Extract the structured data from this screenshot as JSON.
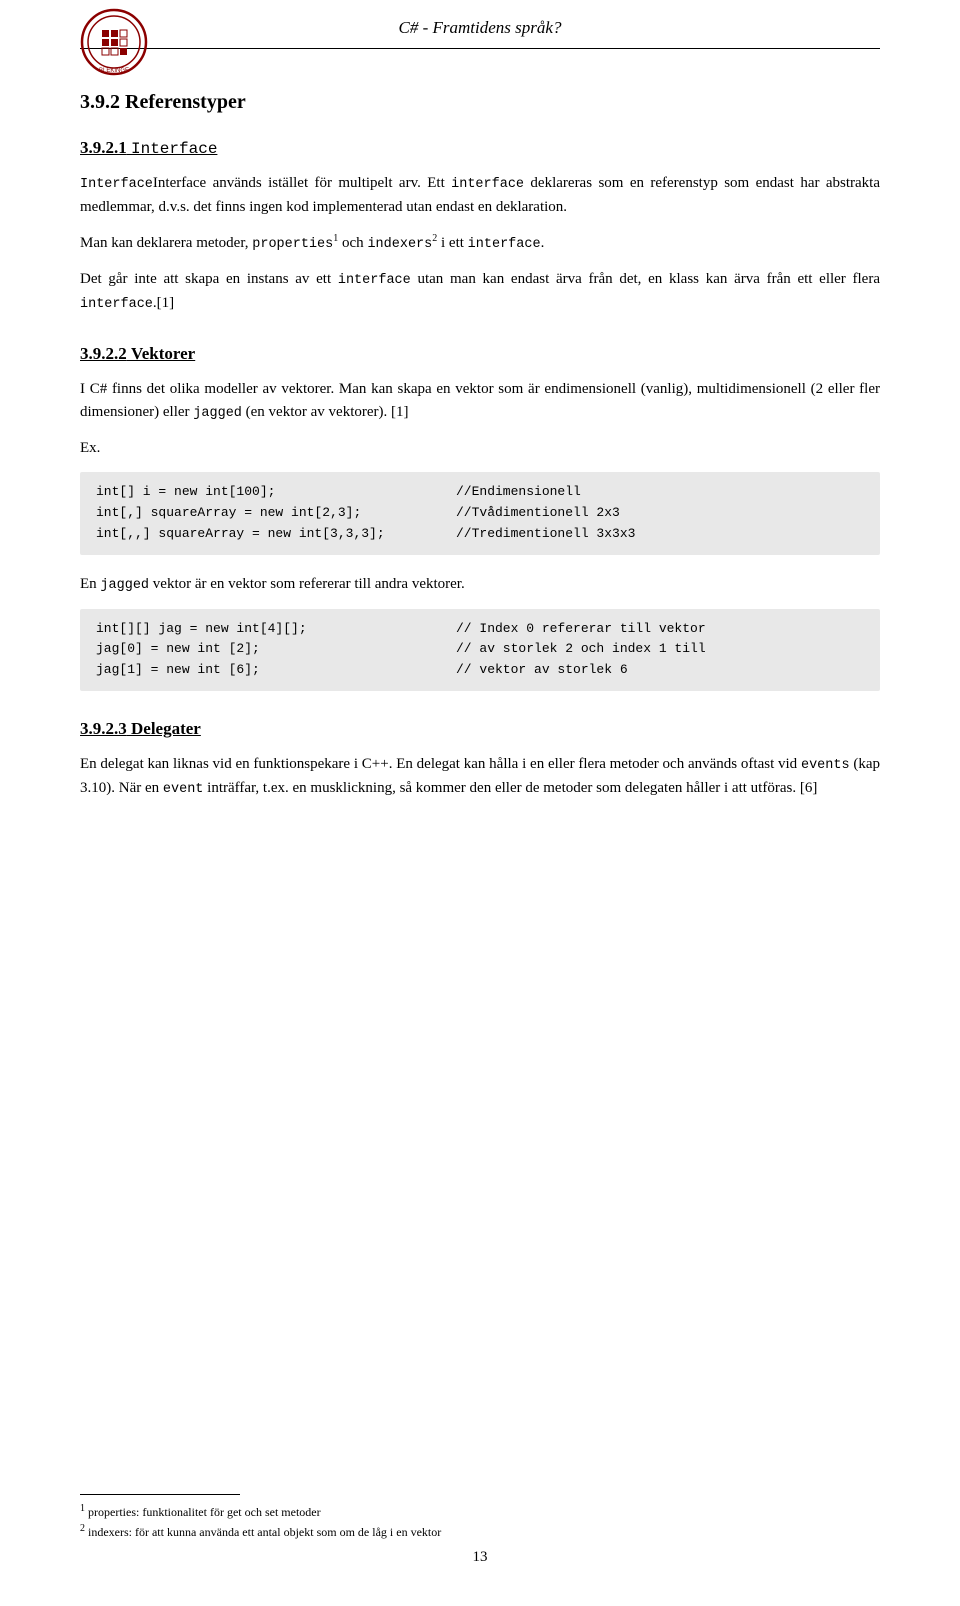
{
  "header": {
    "title": "C# - Framtidens språk?"
  },
  "sections": {
    "s392": {
      "label": "3.9.2 Referenstyper"
    },
    "s3921": {
      "label": "3.9.2.1",
      "keyword": "Interface"
    },
    "s3921_p1": "Interface används istället för multipelt arv. Ett ",
    "s3921_p1_mono": "interface",
    "s3921_p1b": " deklareras som en referenstyp som endast har abstrakta medlemmar, d.v.s. det finns ingen kod implementerad utan endast en deklaration.",
    "s3921_p2a": "Man kan deklarera metoder, ",
    "s3921_p2_props": "properties",
    "s3921_p2_sup1": "1",
    "s3921_p2b": " och ",
    "s3921_p2_idx": "indexers",
    "s3921_p2_sup2": "2",
    "s3921_p2c": " i ett ",
    "s3921_p2_if": "interface",
    "s3921_p2d": ".",
    "s3921_p3a": "Det går inte att skapa en instans av ett ",
    "s3921_p3_if": "interface",
    "s3921_p3b": " utan man kan endast ärva från det, en klass kan ärva från ett eller flera ",
    "s3921_p3_if2": "interface",
    "s3921_p3c": ".[1]",
    "s3922": {
      "label": "3.9.2.2",
      "keyword": "Vektorer"
    },
    "s3922_p1": "I C# finns det olika modeller av vektorer. Man kan skapa en vektor som är endimensionell (vanlig), multidimensionell (2 eller fler dimensioner) eller ",
    "s3922_p1_jagged": "jagged",
    "s3922_p1b": " (en vektor av vektorer). [1]",
    "s3922_ex": "Ex.",
    "code1": [
      {
        "left": "int[] i = new int[100];",
        "right": "//Endimensionell"
      },
      {
        "left": "int[,] squareArray = new int[2,3];",
        "right": "//Tvådimentionell 2x3"
      },
      {
        "left": "int[,,] squareArray = new int[3,3,3];",
        "right": "//Tredimentionell 3x3x3"
      }
    ],
    "s3922_p2a": "En ",
    "s3922_p2_jagged": "jagged",
    "s3922_p2b": " vektor är en vektor som refererar till andra vektorer.",
    "code2": [
      {
        "left": "int[][] jag = new int[4][];",
        "right": "// Index 0 refererar till vektor"
      },
      {
        "left": "jag[0] = new int [2];",
        "right": "// av storlek 2 och index 1 till"
      },
      {
        "left": "jag[1] = new int [6];",
        "right": "// vektor av storlek 6"
      }
    ],
    "s3923": {
      "label": "3.9.2.3",
      "keyword": "Delegater"
    },
    "s3923_p1": "En delegat kan liknas vid en funktionspekare i C++. En delegat kan hålla i en eller flera metoder och används oftast vid ",
    "s3923_p1_ev": "events",
    "s3923_p1b": " (kap 3.10). När en ",
    "s3923_p1_ev2": "event",
    "s3923_p1c": " inträffar, t.ex. en musklickning, så kommer den eller de metoder som delegaten håller i att utföras. [6]"
  },
  "footnotes": {
    "fn1_sup": "1",
    "fn1_text": "properties: funktionalitet för get och set metoder",
    "fn2_sup": "2",
    "fn2_text": "indexers: för att kunna använda ett antal objekt som om de låg i en vektor"
  },
  "page_number": "13"
}
